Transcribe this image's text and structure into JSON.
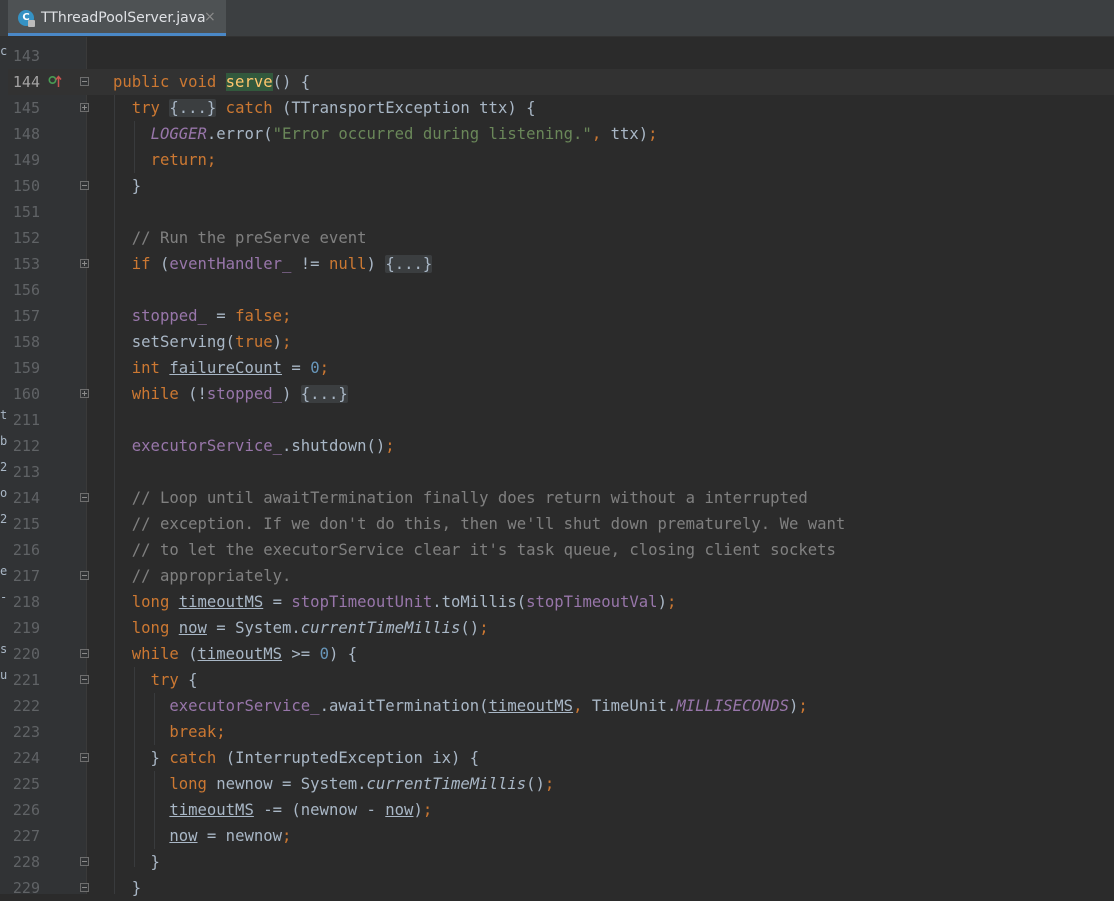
{
  "tab": {
    "title": "TThreadPoolServer.java",
    "icon": "java-class-icon",
    "close": "×"
  },
  "left_strip": {
    "chars": [
      "c",
      "",
      "",
      "",
      "",
      "",
      "",
      "",
      "",
      "",
      "",
      "",
      "",
      "",
      "t",
      "b",
      "2",
      "o",
      "2",
      "",
      "e",
      "-",
      "",
      "s",
      "u"
    ]
  },
  "colors": {
    "background": "#2b2b2b",
    "keyword": "#cc7832",
    "field": "#9876aa",
    "string": "#6a8759",
    "number": "#6897bb",
    "comment": "#808080",
    "tab_underline": "#4a88c7"
  },
  "lines": [
    {
      "n": "143",
      "fold": "",
      "code": []
    },
    {
      "n": "144",
      "fold": "minus",
      "current": true,
      "marker": "override-implements-icon",
      "code": [
        [
          "k",
          "public void "
        ],
        [
          "hl",
          "serve"
        ],
        [
          "",
          "() {"
        ]
      ]
    },
    {
      "n": "145",
      "fold": "plus",
      "code": [
        [
          "",
          "  "
        ],
        [
          "k",
          "try "
        ],
        [
          "folded",
          "{...}"
        ],
        [
          "k",
          " catch "
        ],
        [
          "",
          "(TTransportException ttx) {"
        ]
      ]
    },
    {
      "n": "148",
      "fold": "",
      "code": [
        [
          "",
          "    "
        ],
        [
          "fi",
          "LOGGER"
        ],
        [
          "",
          ".error("
        ],
        [
          "s",
          "\"Error occurred during listening.\""
        ],
        [
          "k",
          ", "
        ],
        [
          "",
          "ttx)"
        ],
        [
          "k",
          ";"
        ]
      ]
    },
    {
      "n": "149",
      "fold": "",
      "code": [
        [
          "",
          "    "
        ],
        [
          "k",
          "return;"
        ]
      ]
    },
    {
      "n": "150",
      "fold": "minus",
      "code": [
        [
          "",
          "  }"
        ]
      ]
    },
    {
      "n": "151",
      "fold": "",
      "code": []
    },
    {
      "n": "152",
      "fold": "",
      "code": [
        [
          "",
          "  "
        ],
        [
          "c",
          "// Run the preServe event"
        ]
      ]
    },
    {
      "n": "153",
      "fold": "plus",
      "code": [
        [
          "",
          "  "
        ],
        [
          "k",
          "if "
        ],
        [
          "",
          "("
        ],
        [
          "f",
          "eventHandler_"
        ],
        [
          "",
          " != "
        ],
        [
          "k",
          "null"
        ],
        [
          "",
          ") "
        ],
        [
          "folded",
          "{...}"
        ]
      ]
    },
    {
      "n": "156",
      "fold": "",
      "code": []
    },
    {
      "n": "157",
      "fold": "",
      "code": [
        [
          "",
          "  "
        ],
        [
          "f",
          "stopped_"
        ],
        [
          "",
          " = "
        ],
        [
          "k",
          "false;"
        ]
      ]
    },
    {
      "n": "158",
      "fold": "",
      "code": [
        [
          "",
          "  setServing("
        ],
        [
          "k",
          "true"
        ],
        [
          "",
          ")"
        ],
        [
          "k",
          ";"
        ]
      ]
    },
    {
      "n": "159",
      "fold": "",
      "code": [
        [
          "",
          "  "
        ],
        [
          "k",
          "int "
        ],
        [
          "u",
          "failureCount"
        ],
        [
          "",
          " = "
        ],
        [
          "n",
          "0"
        ],
        [
          "k",
          ";"
        ]
      ]
    },
    {
      "n": "160",
      "fold": "plus",
      "code": [
        [
          "",
          "  "
        ],
        [
          "k",
          "while "
        ],
        [
          "",
          "(!"
        ],
        [
          "f",
          "stopped_"
        ],
        [
          "",
          ") "
        ],
        [
          "folded",
          "{...}"
        ]
      ]
    },
    {
      "n": "211",
      "fold": "",
      "code": []
    },
    {
      "n": "212",
      "fold": "",
      "code": [
        [
          "",
          "  "
        ],
        [
          "f",
          "executorService_"
        ],
        [
          "",
          ".shutdown()"
        ],
        [
          "k",
          ";"
        ]
      ]
    },
    {
      "n": "213",
      "fold": "",
      "code": []
    },
    {
      "n": "214",
      "fold": "minus",
      "code": [
        [
          "",
          "  "
        ],
        [
          "c",
          "// Loop until awaitTermination finally does return without a interrupted"
        ]
      ]
    },
    {
      "n": "215",
      "fold": "",
      "code": [
        [
          "",
          "  "
        ],
        [
          "c",
          "// exception. If we don't do this, then we'll shut down prematurely. We want"
        ]
      ]
    },
    {
      "n": "216",
      "fold": "",
      "code": [
        [
          "",
          "  "
        ],
        [
          "c",
          "// to let the executorService clear it's task queue, closing client sockets"
        ]
      ]
    },
    {
      "n": "217",
      "fold": "minus",
      "code": [
        [
          "",
          "  "
        ],
        [
          "c",
          "// appropriately."
        ]
      ]
    },
    {
      "n": "218",
      "fold": "",
      "code": [
        [
          "",
          "  "
        ],
        [
          "k",
          "long "
        ],
        [
          "u",
          "timeoutMS"
        ],
        [
          "",
          " = "
        ],
        [
          "f",
          "stopTimeoutUnit"
        ],
        [
          "",
          ".toMillis("
        ],
        [
          "f",
          "stopTimeoutVal"
        ],
        [
          "",
          ")"
        ],
        [
          "k",
          ";"
        ]
      ]
    },
    {
      "n": "219",
      "fold": "",
      "code": [
        [
          "",
          "  "
        ],
        [
          "k",
          "long "
        ],
        [
          "u",
          "now"
        ],
        [
          "",
          " = System."
        ],
        [
          "i",
          "currentTimeMillis"
        ],
        [
          "",
          "()"
        ],
        [
          "k",
          ";"
        ]
      ]
    },
    {
      "n": "220",
      "fold": "minus",
      "code": [
        [
          "",
          "  "
        ],
        [
          "k",
          "while "
        ],
        [
          "",
          "("
        ],
        [
          "u",
          "timeoutMS"
        ],
        [
          "",
          " >= "
        ],
        [
          "n",
          "0"
        ],
        [
          "",
          ") {"
        ]
      ]
    },
    {
      "n": "221",
      "fold": "minus",
      "code": [
        [
          "",
          "    "
        ],
        [
          "k",
          "try "
        ],
        [
          "",
          "{"
        ]
      ]
    },
    {
      "n": "222",
      "fold": "",
      "code": [
        [
          "",
          "      "
        ],
        [
          "f",
          "executorService_"
        ],
        [
          "",
          ".awaitTermination("
        ],
        [
          "u",
          "timeoutMS"
        ],
        [
          "k",
          ", "
        ],
        [
          "",
          "TimeUnit."
        ],
        [
          "fi",
          "MILLISECONDS"
        ],
        [
          "",
          ")"
        ],
        [
          "k",
          ";"
        ]
      ]
    },
    {
      "n": "223",
      "fold": "",
      "code": [
        [
          "",
          "      "
        ],
        [
          "k",
          "break;"
        ]
      ]
    },
    {
      "n": "224",
      "fold": "minus",
      "code": [
        [
          "",
          "    } "
        ],
        [
          "k",
          "catch "
        ],
        [
          "",
          "(InterruptedException ix) {"
        ]
      ]
    },
    {
      "n": "225",
      "fold": "",
      "code": [
        [
          "",
          "      "
        ],
        [
          "k",
          "long "
        ],
        [
          "",
          "newnow = System."
        ],
        [
          "i",
          "currentTimeMillis"
        ],
        [
          "",
          "()"
        ],
        [
          "k",
          ";"
        ]
      ]
    },
    {
      "n": "226",
      "fold": "",
      "code": [
        [
          "",
          "      "
        ],
        [
          "u",
          "timeoutMS"
        ],
        [
          "",
          " -= (newnow - "
        ],
        [
          "u",
          "now"
        ],
        [
          "",
          ")"
        ],
        [
          "k",
          ";"
        ]
      ]
    },
    {
      "n": "227",
      "fold": "",
      "code": [
        [
          "",
          "      "
        ],
        [
          "u",
          "now"
        ],
        [
          "",
          " = newnow"
        ],
        [
          "k",
          ";"
        ]
      ]
    },
    {
      "n": "228",
      "fold": "minus",
      "code": [
        [
          "",
          "    }"
        ]
      ]
    },
    {
      "n": "229",
      "fold": "minus",
      "code": [
        [
          "",
          "  }"
        ]
      ]
    }
  ]
}
